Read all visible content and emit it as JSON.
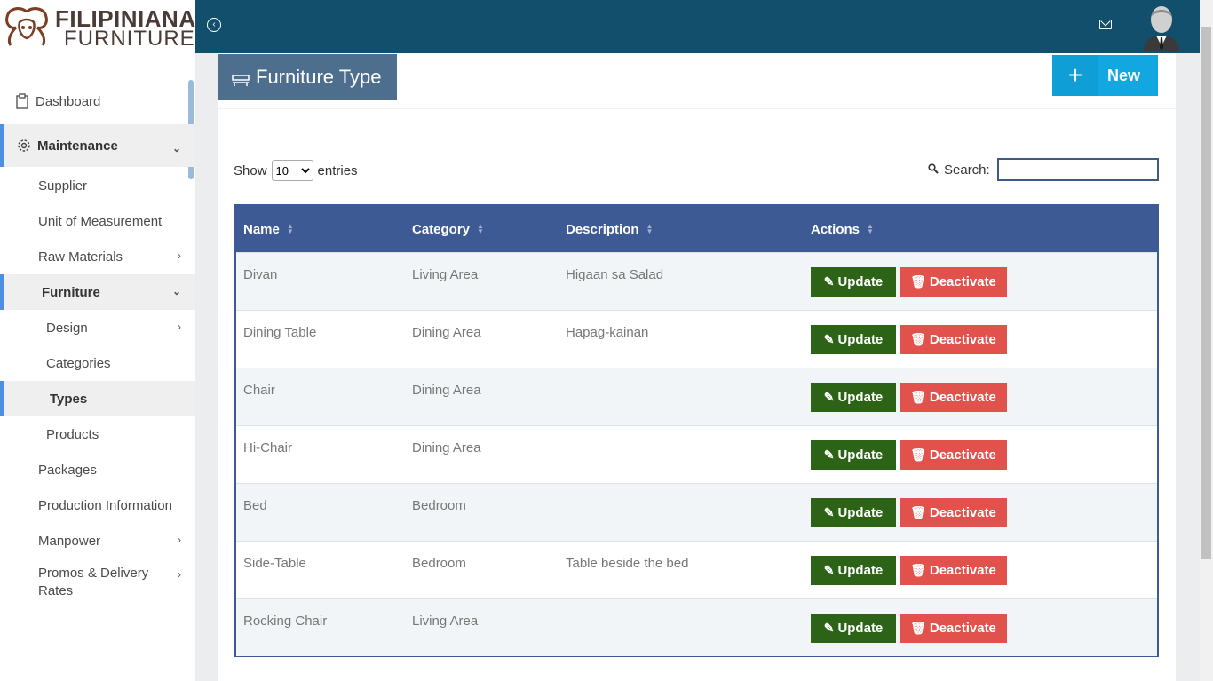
{
  "brand": {
    "line1": "FILIPINIANA",
    "line2": "FURNITURE"
  },
  "sidebar": {
    "items": [
      {
        "label": "Dashboard"
      },
      {
        "label": "Maintenance"
      },
      {
        "label": "Supplier"
      },
      {
        "label": "Unit of Measurement"
      },
      {
        "label": "Raw Materials"
      },
      {
        "label": "Furniture"
      },
      {
        "label": "Design"
      },
      {
        "label": "Categories"
      },
      {
        "label": "Types"
      },
      {
        "label": "Products"
      },
      {
        "label": "Packages"
      },
      {
        "label": "Production Information"
      },
      {
        "label": "Manpower"
      },
      {
        "label": "Promos & Delivery"
      },
      {
        "label": "Rates"
      }
    ]
  },
  "page": {
    "title": "Furniture Type",
    "new_label": "New"
  },
  "table_controls": {
    "show_label": "Show",
    "entries_value": "10",
    "entries_label": "entries",
    "search_label": "Search:",
    "search_value": ""
  },
  "table": {
    "headers": [
      "Name",
      "Category",
      "Description",
      "Actions"
    ],
    "update_label": "Update",
    "deactivate_label": "Deactivate",
    "rows": [
      {
        "name": "Divan",
        "category": "Living Area",
        "description": "Higaan sa Salad"
      },
      {
        "name": "Dining Table",
        "category": "Dining Area",
        "description": "Hapag-kainan"
      },
      {
        "name": "Chair",
        "category": "Dining Area",
        "description": ""
      },
      {
        "name": "Hi-Chair",
        "category": "Dining Area",
        "description": ""
      },
      {
        "name": "Bed",
        "category": "Bedroom",
        "description": ""
      },
      {
        "name": "Side-Table",
        "category": "Bedroom",
        "description": "Table beside the bed"
      },
      {
        "name": "Rocking Chair",
        "category": "Living Area",
        "description": ""
      }
    ]
  },
  "colors": {
    "topbar": "#124f6d",
    "table_header": "#3d5a94",
    "update_button": "#2d6316",
    "deactivate_button": "#e0524b",
    "new_button": "#12a7e0",
    "title_box": "#4e6e8e",
    "active_indicator": "#4e8fe0"
  }
}
